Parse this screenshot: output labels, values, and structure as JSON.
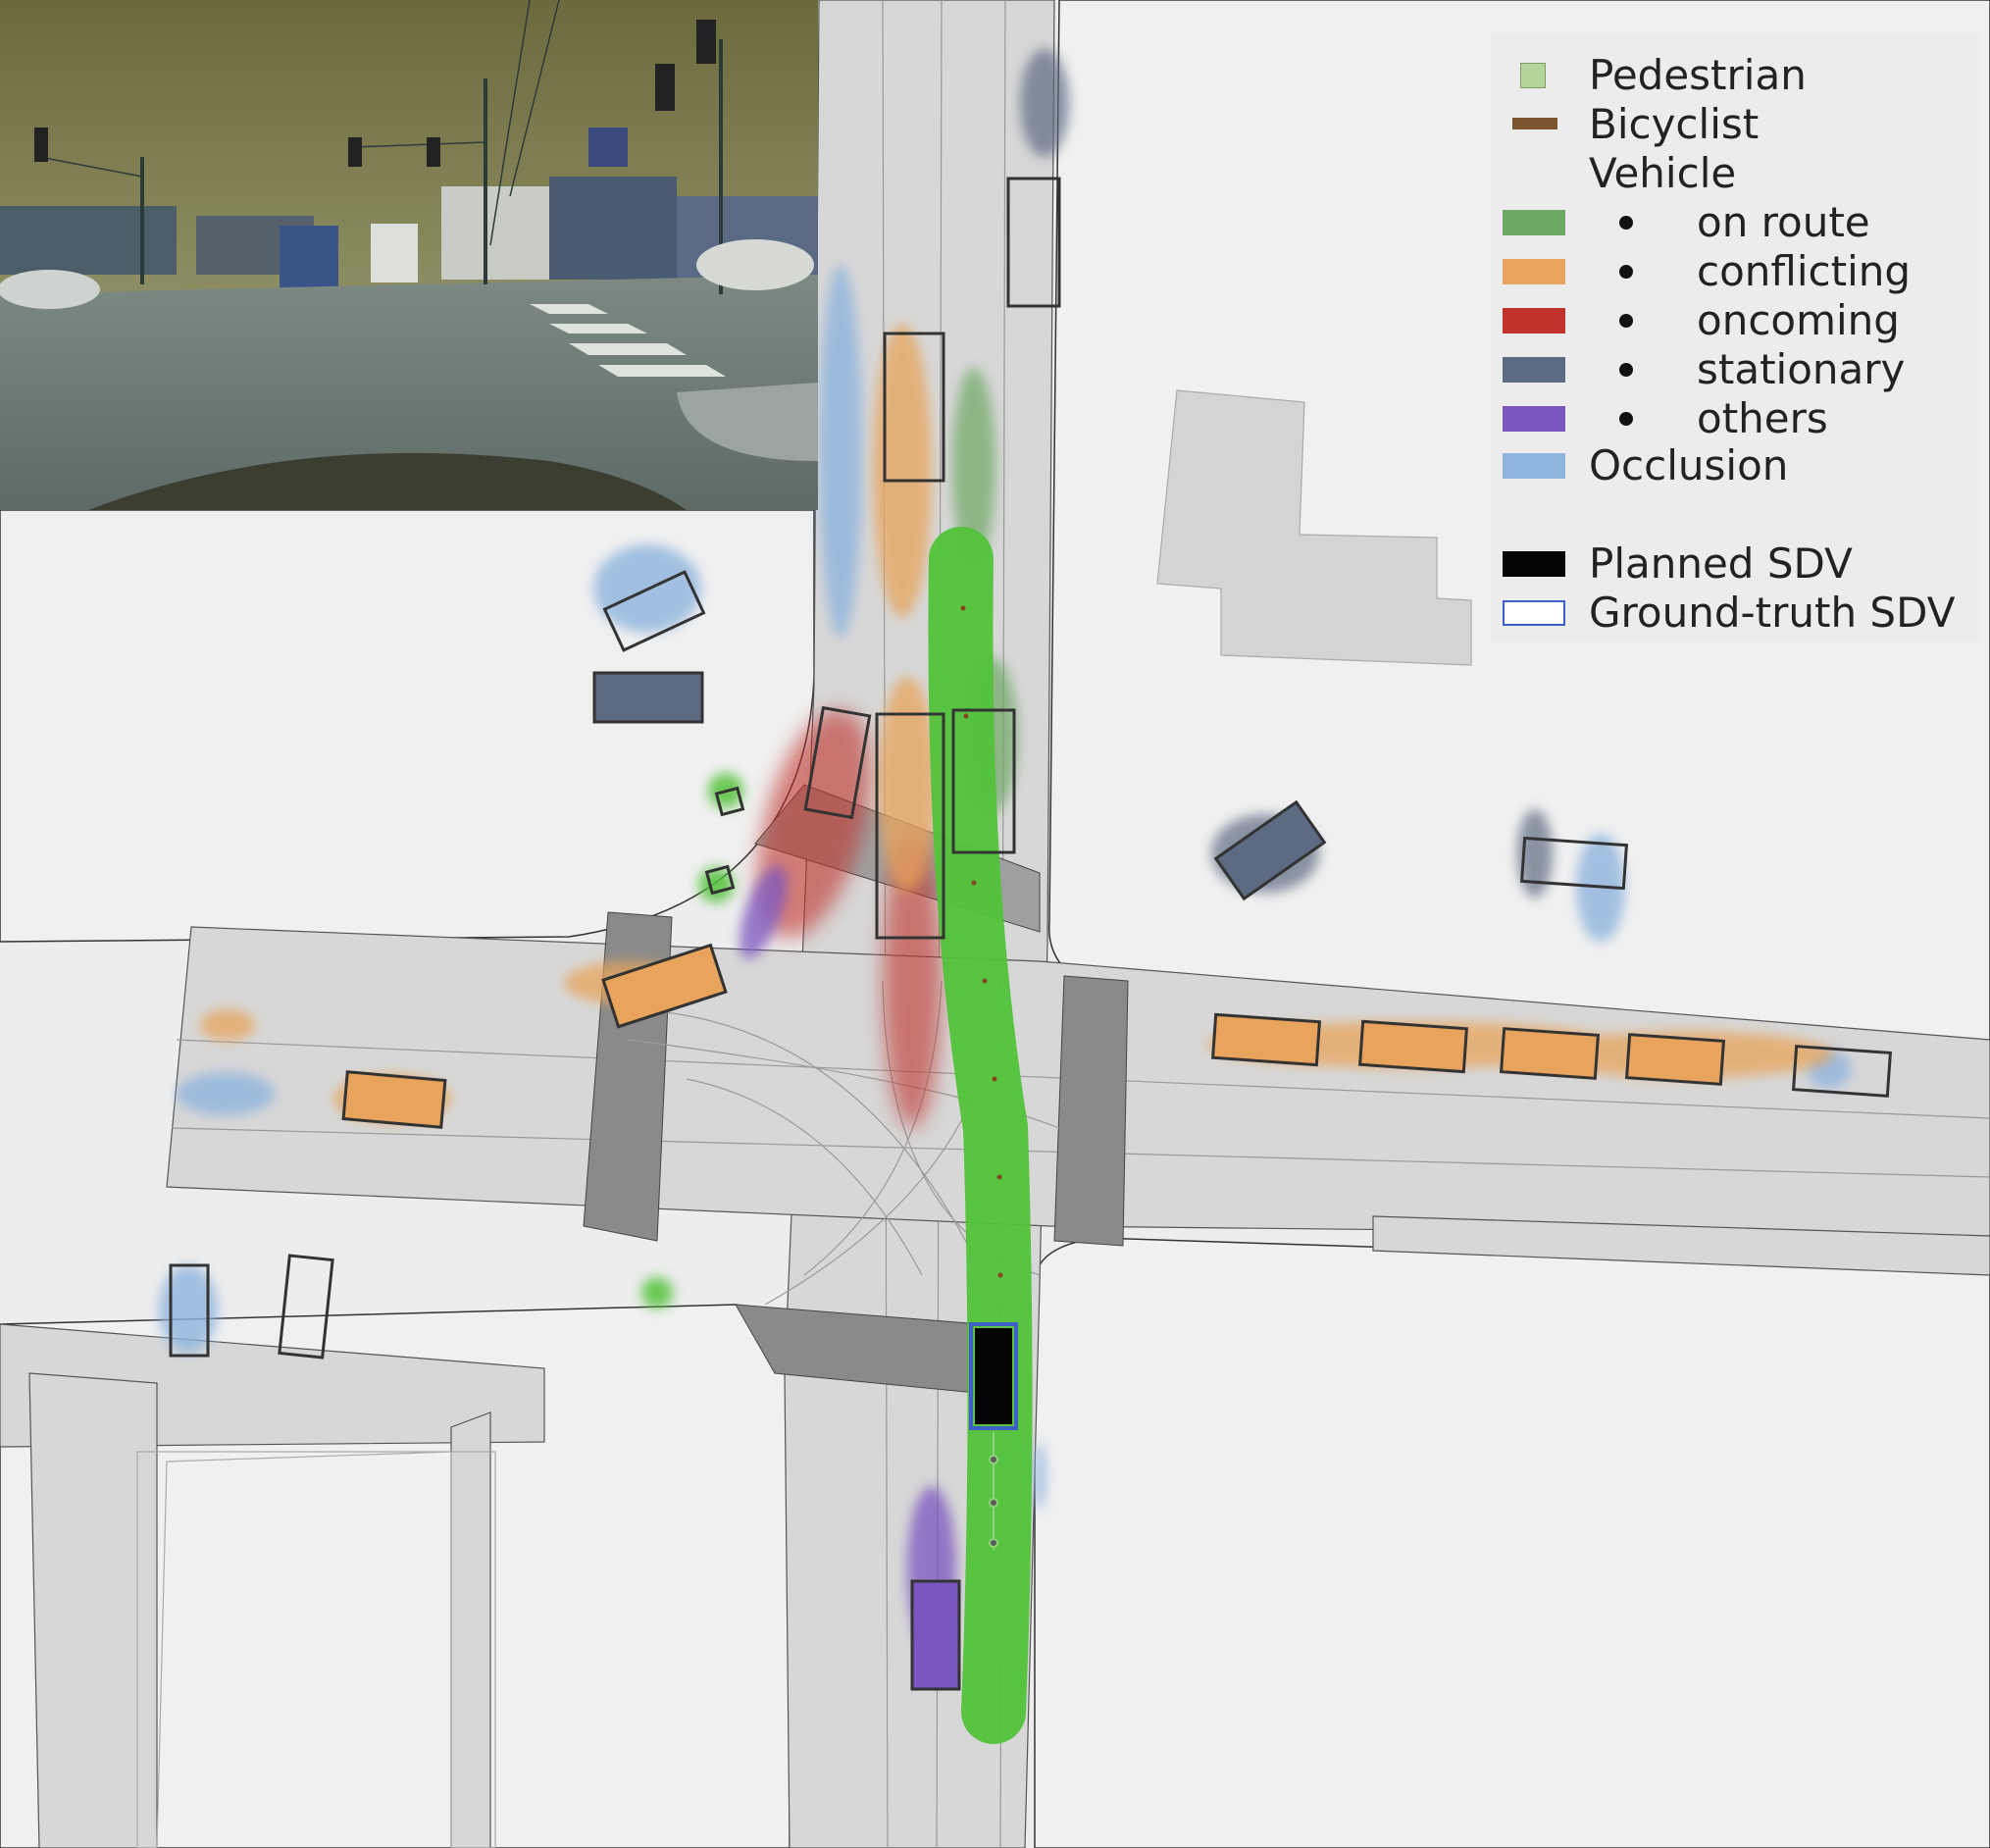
{
  "legend": {
    "pedestrian": "Pedestrian",
    "bicyclist": "Bicyclist",
    "vehicle": "Vehicle",
    "on_route": "on route",
    "conflicting": "conflicting",
    "oncoming": "oncoming",
    "stationary": "stationary",
    "others": "others",
    "occlusion": "Occlusion",
    "planned_sdv": "Planned SDV",
    "ground_truth_sdv": "Ground-truth SDV"
  },
  "colors": {
    "pedestrian": "#b5d49a",
    "bicyclist": "#7a5530",
    "on_route": "#6ea865",
    "conflicting": "#e8a45c",
    "oncoming": "#c0332a",
    "stationary": "#5d6b82",
    "others": "#7a55c0",
    "occlusion": "#8fb4de",
    "planned_sdv": "#050505",
    "ground_truth_sdv": "#3f5fc8",
    "planned_route": "#52c23a"
  },
  "icons": {
    "camera": "front-camera-view-icon"
  }
}
